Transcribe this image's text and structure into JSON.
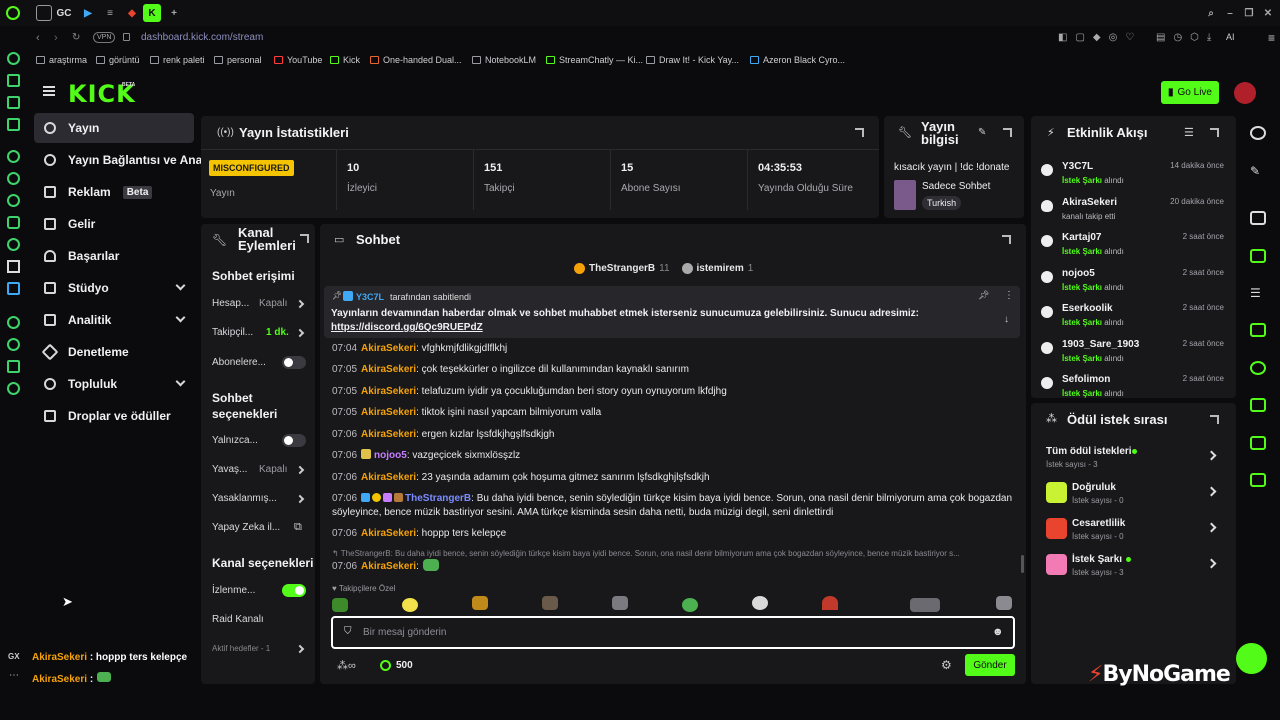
{
  "browser": {
    "tabs": [
      "GC",
      "K"
    ],
    "vpn": "VPN",
    "url": "dashboard.kick.com/stream",
    "bookmarks": [
      "araştırma",
      "görüntü",
      "renk paleti",
      "personal",
      "YouTube",
      "Kick",
      "One-handed Dual...",
      "NotebookLM",
      "StreamChatly — Ki...",
      "Draw It! - Kick Yay...",
      "Azeron Black Cyro..."
    ],
    "ai_label": "AI",
    "gx_label": "GX"
  },
  "header": {
    "logo": "KICK",
    "logo_badge": "BETA",
    "go_live": "Go Live"
  },
  "sidebar": {
    "items": [
      {
        "label": "Yayın"
      },
      {
        "label": "Yayın Bağlantısı ve Anahtarı"
      },
      {
        "label": "Reklam",
        "badge": "Beta"
      },
      {
        "label": "Gelir"
      },
      {
        "label": "Başarılar"
      },
      {
        "label": "Stüdyo"
      },
      {
        "label": "Analitik"
      },
      {
        "label": "Denetleme"
      },
      {
        "label": "Topluluk"
      },
      {
        "label": "Droplar ve ödüller"
      }
    ]
  },
  "stats": {
    "title": "Yayın İstatistikleri",
    "status_badge": "MISCONFIGURED",
    "status_label": "Yayın",
    "cells": [
      {
        "value": "10",
        "label": "İzleyici"
      },
      {
        "value": "151",
        "label": "Takipçi"
      },
      {
        "value": "15",
        "label": "Abone Sayısı"
      },
      {
        "value": "04:35:53",
        "label": "Yayında Olduğu Süre"
      }
    ]
  },
  "stream_info": {
    "title": "Yayın bilgisi",
    "stream_title": "kısacık yayın | !dc !donate",
    "category": "Sadece Sohbet",
    "language": "Turkish"
  },
  "channel_actions": {
    "title": "Kanal Eylemleri",
    "chat_access_title": "Sohbet erişimi",
    "rows1": [
      {
        "label": "Hesap...",
        "value": "Kapalı"
      },
      {
        "label": "Takipçil...",
        "value": "1 dk."
      },
      {
        "label": "Abonelere..."
      }
    ],
    "chat_options_title": "Sohbet seçenekleri",
    "rows2": [
      {
        "label": "Yalnızca..."
      },
      {
        "label": "Yavaş...",
        "value": "Kapalı"
      },
      {
        "label": "Yasaklanmış..."
      },
      {
        "label": "Yapay Zeka il..."
      }
    ],
    "channel_options_title": "Kanal seçenekleri",
    "rows3": [
      {
        "label": "İzlenme..."
      },
      {
        "label": "Raid Kanalı"
      },
      {
        "label": "Aktif hedefler - 1"
      }
    ]
  },
  "chat": {
    "title": "Sohbet",
    "top_chatters": [
      {
        "name": "TheStrangerB",
        "count": "11"
      },
      {
        "name": "istemirem",
        "count": "1"
      }
    ],
    "pinned_by": "Y3C7L",
    "pinned_suffix": "tarafından sabitlendi",
    "pinned_text": "Yayınların devamından haberdar olmak ve sohbet muhabbet etmek isterseniz sunucumuza gelebilirsiniz. Sunucu adresimiz:",
    "pinned_link": "https://discord.gg/6Qc9RUEPdZ",
    "messages": [
      {
        "time": "07:04",
        "user": "AkiraSekeri",
        "text": ": vfghkmjfdlikgjdlflkhj"
      },
      {
        "time": "07:05",
        "user": "AkiraSekeri",
        "text": ": çok teşekkürler o ingilizce dil kullanımından kaynaklı sanırım"
      },
      {
        "time": "07:05",
        "user": "AkiraSekeri",
        "text": ": telafuzum iyidir ya çocukluğumdan beri story oyun oynuyorum lkfdjhg"
      },
      {
        "time": "07:05",
        "user": "AkiraSekeri",
        "text": ": tiktok işini nasıl yapcam bilmiyorum valla"
      },
      {
        "time": "07:06",
        "user": "AkiraSekeri",
        "text": ": ergen kızlar lşsfdkjhgşlfsdkjgh"
      },
      {
        "time": "07:06",
        "user": "nojoo5",
        "text": ": vazgeçicek sixmxlösşzlz"
      },
      {
        "time": "07:06",
        "user": "AkiraSekeri",
        "text": ": 23 yaşında adamım çok hoşuma gitmez sanırım lşfsdkghjlşfsdkjh"
      },
      {
        "time": "07:06",
        "user": "TheStrangerB",
        "text": ": Bu daha iyidi bence, senin söylediğin türkçe kisim baya iyidi bence. Sorun, ona nasil denir bilmiyorum ama çok bogazdan söyleyince, bence müzik bastiriyor sesini. AMA türkçe kisminda sesin daha netti, buda müzigi degil, seni dinlettirdi"
      },
      {
        "time": "07:06",
        "user": "AkiraSekeri",
        "text": ": hoppp ters kelepçe"
      }
    ],
    "reply_preview": "TheStrangerB: Bu daha iyidi bence, senin söylediğin türkçe kisim baya iyidi bence. Sorun, ona nasil denir bilmiyorum ama çok bogazdan söyleyince, bence müzik bastiriyor s...",
    "last_msg": {
      "time": "07:06",
      "user": "AkiraSekeri",
      "text": ":"
    },
    "followers_only": "Takipçilere Özel",
    "input_placeholder": "Bir mesaj gönderin",
    "points": "500",
    "send": "Gönder"
  },
  "activity": {
    "title": "Etkinlik Akışı",
    "items": [
      {
        "name": "Y3C7L",
        "tag": "İstek Şarkı",
        "action": "alındı",
        "time": "14 dakika önce"
      },
      {
        "name": "AkiraSekeri",
        "tag": "",
        "action": "kanalı takip etti",
        "time": "20 dakika önce"
      },
      {
        "name": "Kartaj07",
        "tag": "İstek Şarkı",
        "action": "alındı",
        "time": "2 saat önce"
      },
      {
        "name": "nojoo5",
        "tag": "İstek Şarkı",
        "action": "alındı",
        "time": "2 saat önce"
      },
      {
        "name": "Eserkoolik",
        "tag": "İstek Şarkı",
        "action": "alındı",
        "time": "2 saat önce"
      },
      {
        "name": "1903_Sare_1903",
        "tag": "İstek Şarkı",
        "action": "alındı",
        "time": "2 saat önce"
      },
      {
        "name": "Sefolimon",
        "tag": "İstek Şarkı",
        "action": "alındı",
        "time": "2 saat önce"
      }
    ]
  },
  "rewards": {
    "title": "Ödül istek sırası",
    "items": [
      {
        "name": "Tüm ödül istekleri",
        "sub": "İstek sayısı - 3",
        "color": "#2a2a30"
      },
      {
        "name": "Doğruluk",
        "sub": "İstek sayısı - 0",
        "color": "#c9f232"
      },
      {
        "name": "Cesaretlilik",
        "sub": "İstek sayısı - 0",
        "color": "#e8442e"
      },
      {
        "name": "İstek Şarkı",
        "sub": "İstek sayısı - 3",
        "color": "#f37bb5"
      }
    ]
  },
  "overlay": {
    "chat_lines": [
      {
        "user": "AkiraSekeri",
        "text": " : hoppp ters kelepçe"
      },
      {
        "user": "AkiraSekeri",
        "text": " :"
      }
    ],
    "watermark": "ByNoGame"
  },
  "colors": {
    "accent": "#53fc18",
    "panel": "#18181b",
    "bg": "#0b0b0d",
    "username": "#f5a20a"
  }
}
